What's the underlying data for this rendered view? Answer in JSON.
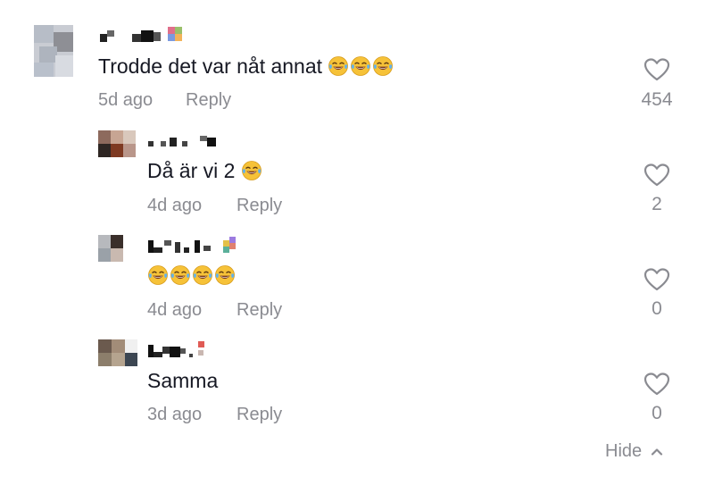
{
  "comments": [
    {
      "text": "Trodde det var nåt annat",
      "emoji_count": 3,
      "time": "5d ago",
      "reply_label": "Reply",
      "likes": "454"
    },
    {
      "text": "Då är vi 2",
      "emoji_count": 1,
      "time": "4d ago",
      "reply_label": "Reply",
      "likes": "2"
    },
    {
      "text": "",
      "emoji_count": 4,
      "time": "4d ago",
      "reply_label": "Reply",
      "likes": "0"
    },
    {
      "text": "Samma",
      "emoji_count": 0,
      "time": "3d ago",
      "reply_label": "Reply",
      "likes": "0"
    }
  ],
  "hide_label": "Hide",
  "icons": {
    "like": "heart-outline-icon",
    "emoji": "face-with-tears-of-joy-emoji",
    "collapse": "chevron-up-icon"
  },
  "colors": {
    "text": "#161823",
    "secondary": "#8a8b91",
    "emoji": "#f6c238"
  }
}
